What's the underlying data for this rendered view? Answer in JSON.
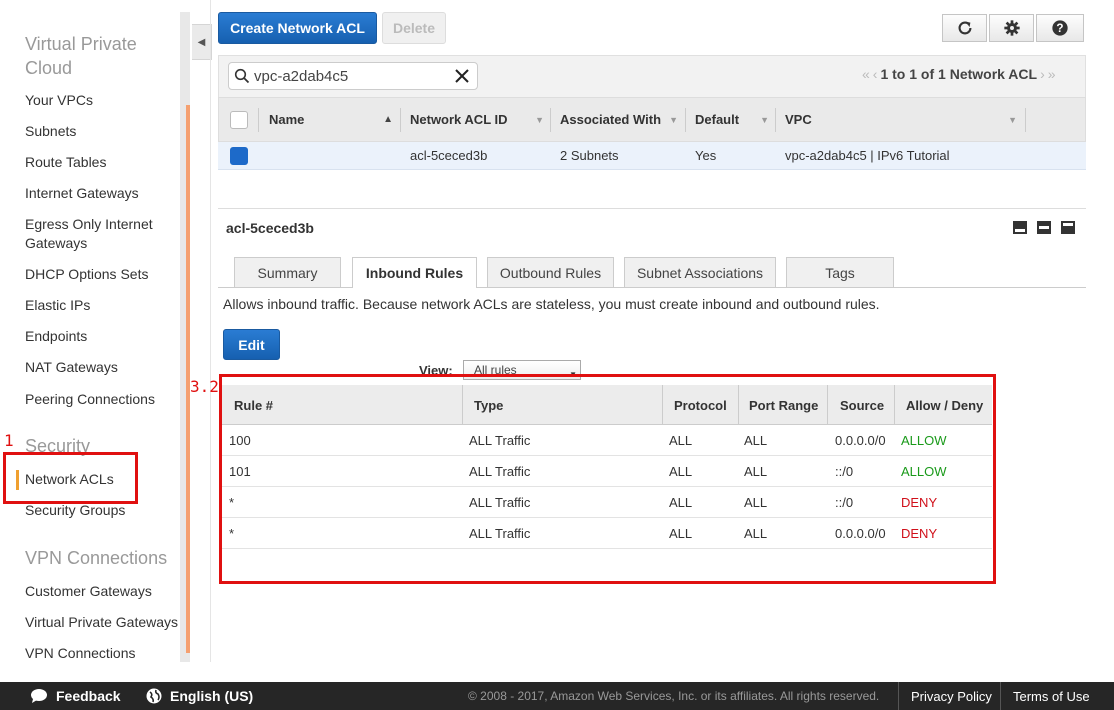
{
  "sidebar": {
    "categories": [
      "Virtual Private Cloud",
      "Security",
      "VPN Connections"
    ],
    "items": [
      "Your VPCs",
      "Subnets",
      "Route Tables",
      "Internet Gateways",
      "Egress Only Internet Gateways",
      "DHCP Options Sets",
      "Elastic IPs",
      "Endpoints",
      "NAT Gateways",
      "Peering Connections",
      "Network ACLs",
      "Security Groups",
      "Customer Gateways",
      "Virtual Private Gateways",
      "VPN Connections"
    ],
    "active": "Network ACLs"
  },
  "annotations": {
    "label_1": "1",
    "label_2": "3.2"
  },
  "toolbar": {
    "create_label": "Create Network ACL",
    "delete_label": "Delete"
  },
  "icons": {
    "refresh": "refresh-icon",
    "settings": "gear-icon",
    "help": "help-icon",
    "search": "search-icon",
    "clear": "close-icon",
    "feedback": "speech-bubble-icon",
    "language": "globe-icon"
  },
  "filter": {
    "search_value": "vpc-a2dab4c5",
    "pager_text": "1 to 1 of 1 Network ACL"
  },
  "table": {
    "columns": [
      "Name",
      "Network ACL ID",
      "Associated With",
      "Default",
      "VPC"
    ],
    "rows": [
      {
        "name": "",
        "acl_id": "acl-5ceced3b",
        "associated": "2 Subnets",
        "default": "Yes",
        "vpc": "vpc-a2dab4c5 | IPv6 Tutorial",
        "selected": true
      }
    ]
  },
  "detail": {
    "title": "acl-5ceced3b",
    "tabs": [
      "Summary",
      "Inbound Rules",
      "Outbound Rules",
      "Subnet Associations",
      "Tags"
    ],
    "active_tab": "Inbound Rules",
    "description": "Allows inbound traffic. Because network ACLs are stateless, you must create inbound and outbound rules.",
    "edit_label": "Edit",
    "view_label": "View:",
    "view_value": "All rules"
  },
  "rules": {
    "columns": [
      "Rule #",
      "Type",
      "Protocol",
      "Port Range",
      "Source",
      "Allow / Deny"
    ],
    "rows": [
      [
        "100",
        "ALL Traffic",
        "ALL",
        "ALL",
        "0.0.0.0/0",
        "ALLOW"
      ],
      [
        "101",
        "ALL Traffic",
        "ALL",
        "ALL",
        "::/0",
        "ALLOW"
      ],
      [
        "*",
        "ALL Traffic",
        "ALL",
        "ALL",
        "::/0",
        "DENY"
      ],
      [
        "*",
        "ALL Traffic",
        "ALL",
        "ALL",
        "0.0.0.0/0",
        "DENY"
      ]
    ]
  },
  "colors": {
    "allow": "#1a9a1a",
    "deny": "#d0101a",
    "primary": "#1d6ac9",
    "highlight": "#e01010"
  },
  "footer": {
    "feedback": "Feedback",
    "language": "English (US)",
    "copyright": "© 2008 - 2017, Amazon Web Services, Inc. or its affiliates. All rights reserved.",
    "privacy": "Privacy Policy",
    "terms": "Terms of Use"
  }
}
